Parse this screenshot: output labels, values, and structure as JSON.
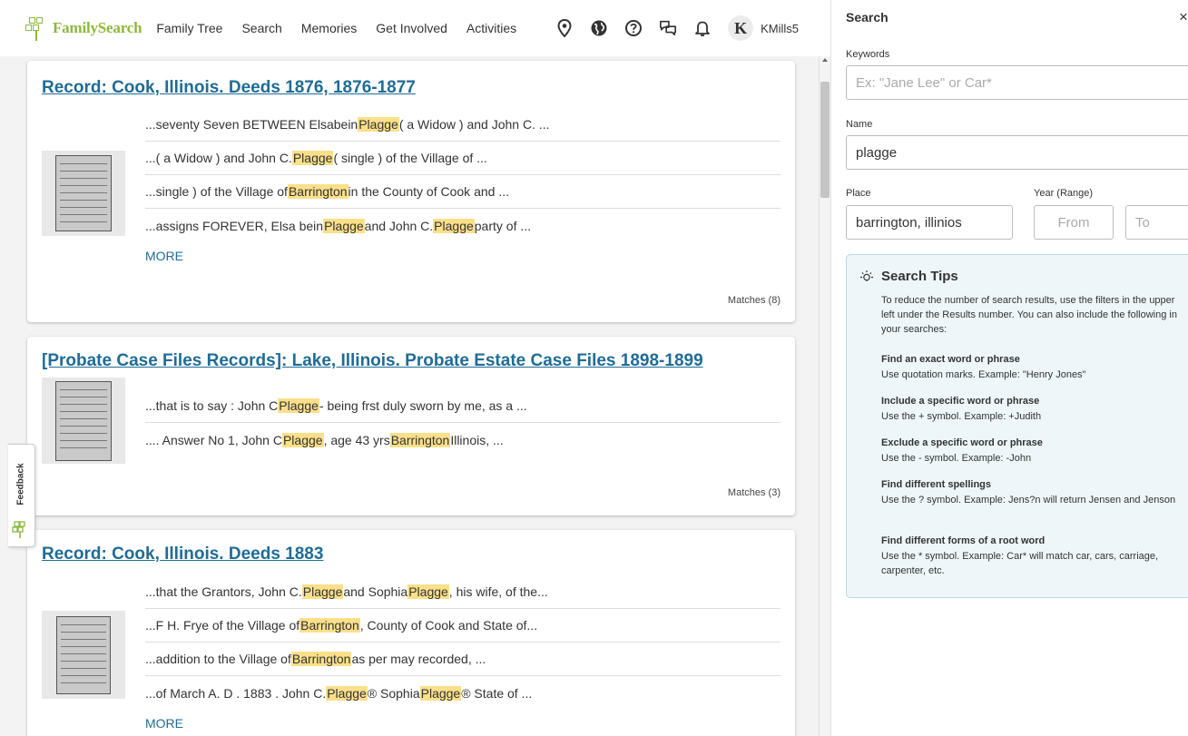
{
  "header": {
    "logo_text": "FamilySearch",
    "nav": [
      "Family Tree",
      "Search",
      "Memories",
      "Get Involved",
      "Activities"
    ],
    "avatar_initial": "K",
    "username": "KMills5"
  },
  "results": [
    {
      "title": "Record: Cook, Illinois. Deeds 1876, 1876-1877",
      "snippets": [
        [
          {
            "t": "...seventy Seven BETWEEN Elsabein "
          },
          {
            "t": "Plagge",
            "h": true
          },
          {
            "t": " ( a Widow ) and John C. ..."
          }
        ],
        [
          {
            "t": "...( a Widow ) and John C. "
          },
          {
            "t": "Plagge",
            "h": true
          },
          {
            "t": " ( single ) of the Village of ..."
          }
        ],
        [
          {
            "t": "...single ) of the Village of "
          },
          {
            "t": "Barrington",
            "h": true
          },
          {
            "t": " in the County of Cook and ..."
          }
        ],
        [
          {
            "t": "...assigns FOREVER, Elsa bein "
          },
          {
            "t": "Plagge",
            "h": true
          },
          {
            "t": " and John C. "
          },
          {
            "t": "Plagge",
            "h": true
          },
          {
            "t": " party of ..."
          }
        ]
      ],
      "more": "MORE",
      "matches": "Matches (8)"
    },
    {
      "title": "[Probate Case Files Records]: Lake, Illinois. Probate Estate Case Files 1898-1899",
      "snippets": [
        [
          {
            "t": "...that is to say : John C "
          },
          {
            "t": "Plagge",
            "h": true
          },
          {
            "t": " - being frst duly sworn by me, as a ..."
          }
        ],
        [
          {
            "t": ".... Answer No 1, John C "
          },
          {
            "t": "Plagge",
            "h": true
          },
          {
            "t": ", age 43 yrs "
          },
          {
            "t": "Barrington",
            "h": true
          },
          {
            "t": " Illinois, ..."
          }
        ]
      ],
      "more": "",
      "matches": "Matches (3)"
    },
    {
      "title": "Record: Cook, Illinois. Deeds 1883",
      "snippets": [
        [
          {
            "t": "...that the Grantors, John C. "
          },
          {
            "t": "Plagge",
            "h": true
          },
          {
            "t": " and Sophia "
          },
          {
            "t": "Plagge",
            "h": true
          },
          {
            "t": ", his wife, of the..."
          }
        ],
        [
          {
            "t": "...F H. Frye of the Village of "
          },
          {
            "t": "Barrington",
            "h": true
          },
          {
            "t": ", County of Cook and State of..."
          }
        ],
        [
          {
            "t": "...addition to the Village of "
          },
          {
            "t": "Barrington",
            "h": true
          },
          {
            "t": " as per may recorded, ..."
          }
        ],
        [
          {
            "t": "...of March A. D . 1883 . John C. "
          },
          {
            "t": "Plagge",
            "h": true
          },
          {
            "t": " ® Sophia "
          },
          {
            "t": "Plagge",
            "h": true
          },
          {
            "t": " ® State of ..."
          }
        ]
      ],
      "more": "MORE",
      "matches": ""
    }
  ],
  "feedback": {
    "label": "Feedback"
  },
  "panel": {
    "title": "Search",
    "close": "×",
    "keywords_label": "Keywords",
    "keywords_placeholder": "Ex: \"Jane Lee\" or Car*",
    "name_label": "Name",
    "name_value": "plagge",
    "place_label": "Place",
    "place_value": "barrington, illinios",
    "year_label": "Year (Range)",
    "from_placeholder": "From",
    "to_placeholder": "To"
  },
  "tips": {
    "title": "Search Tips",
    "intro": "To reduce the number of search results, use the filters in the upper left under the Results number. You can also include the following in your searches:",
    "items": [
      {
        "heading": "Find an exact word or phrase",
        "desc": "Use quotation marks. Example: \"Henry Jones\""
      },
      {
        "heading": "Include a specific word or phrase",
        "desc": "Use the + symbol. Example: +Judith"
      },
      {
        "heading": "Exclude a specific word or phrase",
        "desc": "Use the - symbol. Example: -John"
      },
      {
        "heading": "Find different spellings",
        "desc": "Use the ? symbol. Example: Jens?n will return Jensen and Jenson"
      },
      {
        "heading": "Find different forms of a root word",
        "desc": "Use the * symbol. Example: Car* will match car, cars, carriage, carpenter, etc."
      }
    ]
  },
  "colors": {
    "brand_green": "#8cb83c",
    "link_blue": "#1f6c95",
    "highlight": "#fbe08a",
    "tips_bg": "#eef6fa"
  },
  "icons": [
    "location-pin-icon",
    "globe-icon",
    "help-icon",
    "chat-icon",
    "bell-icon",
    "lightbulb-icon"
  ]
}
